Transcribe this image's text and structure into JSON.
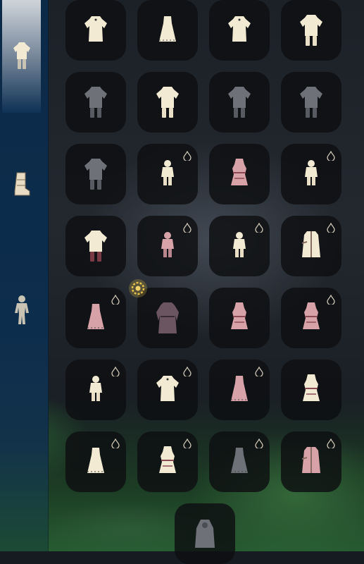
{
  "sidebar": {
    "tabs": [
      {
        "name": "tab-outfits",
        "icon": "outfit-icon",
        "active": true
      },
      {
        "name": "tab-shoes",
        "icon": "boot-icon",
        "active": false
      },
      {
        "name": "tab-body",
        "icon": "body-icon",
        "active": false
      }
    ]
  },
  "grid": {
    "columns": 4,
    "items": [
      {
        "icon": "robe-icon",
        "tone": "light",
        "dyeable": false
      },
      {
        "icon": "dress-icon",
        "tone": "light",
        "dyeable": false
      },
      {
        "icon": "robe-icon",
        "tone": "light",
        "dyeable": false
      },
      {
        "icon": "robe-pants-icon",
        "tone": "light",
        "dyeable": false
      },
      {
        "icon": "robe-pants-icon",
        "tone": "gray",
        "dyeable": false
      },
      {
        "icon": "robe-pants-icon",
        "tone": "light",
        "dyeable": false
      },
      {
        "icon": "robe-pants-icon",
        "tone": "gray",
        "dyeable": false
      },
      {
        "icon": "robe-pants-icon",
        "tone": "gray",
        "dyeable": false
      },
      {
        "icon": "robe-pants-icon",
        "tone": "gray",
        "dyeable": false
      },
      {
        "icon": "small-outfit-icon",
        "tone": "light",
        "dyeable": true
      },
      {
        "icon": "layered-outfit-icon",
        "tone": "pink",
        "dyeable": false
      },
      {
        "icon": "small-outfit-icon",
        "tone": "light",
        "dyeable": true
      },
      {
        "icon": "robe-pants-icon",
        "tone": "light-maroon",
        "dyeable": false
      },
      {
        "icon": "small-outfit-icon",
        "tone": "pink",
        "dyeable": true
      },
      {
        "icon": "small-outfit-icon",
        "tone": "light",
        "dyeable": true
      },
      {
        "icon": "coat-icon",
        "tone": "light",
        "dyeable": true
      },
      {
        "icon": "dress-icon",
        "tone": "pink",
        "dyeable": true
      },
      {
        "icon": "long-robe-icon",
        "tone": "mauve",
        "dyeable": false,
        "badge": "new-badge-icon"
      },
      {
        "icon": "layered-outfit-icon",
        "tone": "pink",
        "dyeable": false
      },
      {
        "icon": "layered-outfit-icon",
        "tone": "pink",
        "dyeable": true
      },
      {
        "icon": "small-outfit-icon",
        "tone": "light",
        "dyeable": true
      },
      {
        "icon": "robe-icon",
        "tone": "light",
        "dyeable": true
      },
      {
        "icon": "dress-icon",
        "tone": "pink",
        "dyeable": true
      },
      {
        "icon": "layered-outfit-icon",
        "tone": "light",
        "dyeable": false
      },
      {
        "icon": "dress-icon",
        "tone": "light",
        "dyeable": true
      },
      {
        "icon": "layered-outfit-icon",
        "tone": "light",
        "dyeable": true
      },
      {
        "icon": "dress-icon",
        "tone": "gray",
        "dyeable": true
      },
      {
        "icon": "coat-icon",
        "tone": "pink",
        "dyeable": true
      },
      {
        "icon": "cloak-icon",
        "tone": "gray",
        "dyeable": false
      }
    ]
  },
  "colors": {
    "light": "#f3ead3",
    "gray": "#6f7178",
    "pink": "#d8a3a8",
    "mauve": "#6b5560",
    "maroon": "#7a3b46",
    "slot_bg": "#0e0f11",
    "sidebar": "#0d2d4d"
  }
}
